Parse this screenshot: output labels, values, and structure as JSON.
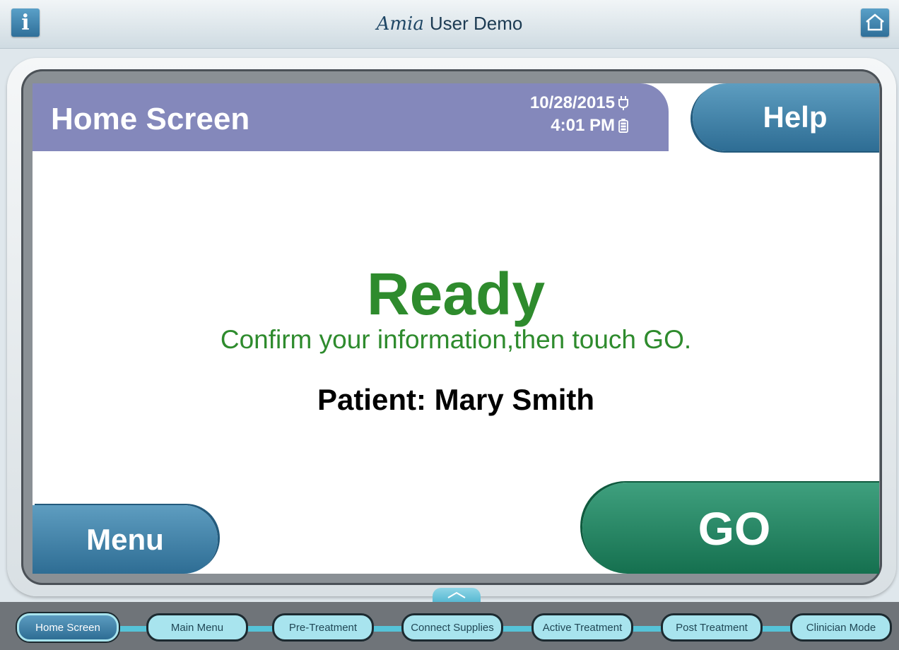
{
  "topbar": {
    "info_label": "i",
    "brand_logo": "Amia",
    "brand_title": "User Demo"
  },
  "header": {
    "title": "Home Screen",
    "date": "10/28/2015",
    "time": "4:01 PM",
    "help_label": "Help"
  },
  "main": {
    "status": "Ready",
    "instruction": "Confirm your information,then touch GO.",
    "patient": "Patient: Mary Smith"
  },
  "actions": {
    "menu_label": "Menu",
    "go_label": "GO"
  },
  "nav": {
    "items": [
      {
        "label": "Home Screen"
      },
      {
        "label": "Main Menu"
      },
      {
        "label": "Pre-Treatment"
      },
      {
        "label": "Connect Supplies"
      },
      {
        "label": "Active Treatment"
      },
      {
        "label": "Post Treatment"
      },
      {
        "label": "Clinician Mode"
      }
    ]
  },
  "colors": {
    "header_bg": "#8488bb",
    "ready_green": "#2e8b2d",
    "go_green": "#15704f",
    "button_blue": "#2e6d94",
    "nav_cyan": "#56c3d8"
  }
}
